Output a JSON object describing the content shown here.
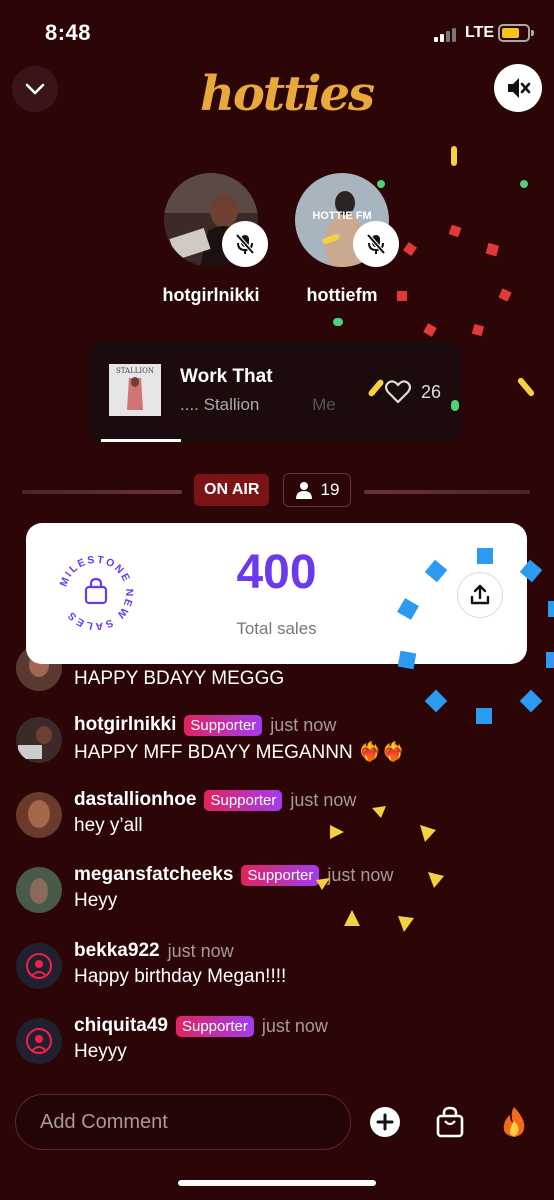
{
  "status": {
    "time": "8:48",
    "network": "LTE"
  },
  "app": {
    "logo": "hotties"
  },
  "hosts": [
    {
      "name": "hotgirlnikki",
      "muted": true
    },
    {
      "name": "hottiefm",
      "muted": true,
      "avatar_text": "HOTTIE FM"
    }
  ],
  "now_playing": {
    "title": "Work That",
    "artist": "....  Stallion",
    "artist_overflow": "Me",
    "likes": "26",
    "album_text": "STALLION"
  },
  "live": {
    "status": "ON AIR",
    "viewers": "19"
  },
  "milestone": {
    "badge_text": "MILESTONE NEW SALES",
    "value": "400",
    "label": "Total sales"
  },
  "comments": [
    {
      "user": "",
      "badge": "",
      "time": "",
      "text": "HAPPY BDAYY MEGGG"
    },
    {
      "user": "hotgirlnikki",
      "badge": "Supporter",
      "time": "just now",
      "text": "HAPPY MFF BDAYY MEGANNN ❤️‍🔥❤️‍🔥"
    },
    {
      "user": "dastallionhoe",
      "badge": "Supporter",
      "time": "just now",
      "text": "hey y’all"
    },
    {
      "user": "megansfatcheeks",
      "badge": "Supporter",
      "time": "just now",
      "text": "Heyy"
    },
    {
      "user": "bekka922",
      "badge": "",
      "time": "just now",
      "text": "Happy birthday Megan!!!!"
    },
    {
      "user": "chiquita49",
      "badge": "Supporter",
      "time": "just now",
      "text": "Heyyy"
    }
  ],
  "composer": {
    "placeholder": "Add Comment"
  },
  "colors": {
    "background": "#2c0507",
    "accent_purple": "#6c3aed",
    "on_air": "#7a1416",
    "logo_gold": "#e8a93a"
  }
}
